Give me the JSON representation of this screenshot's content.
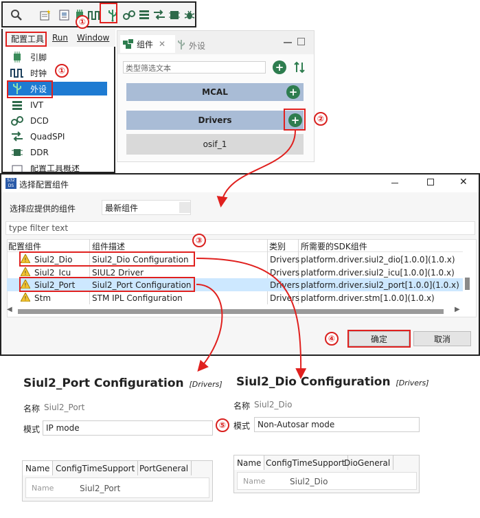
{
  "markers": {
    "m1": "①",
    "m2": "②",
    "m3": "③",
    "m4": "④",
    "m5": "⑤"
  },
  "menu_bar": {
    "items": [
      "配置工具",
      "Run",
      "Window"
    ]
  },
  "left_menu": {
    "items": [
      {
        "label": "引脚",
        "icon": "chip-icon"
      },
      {
        "label": "时钟",
        "icon": "clock-wave-icon"
      },
      {
        "label": "外设",
        "icon": "usb-icon"
      },
      {
        "label": "IVT",
        "icon": "list-icon"
      },
      {
        "label": "DCD",
        "icon": "dcd-icon"
      },
      {
        "label": "QuadSPI",
        "icon": "quadspi-icon"
      },
      {
        "label": "DDR",
        "icon": "ddr-icon"
      },
      {
        "label": "配置工具概述",
        "icon": "overview-icon"
      }
    ]
  },
  "component_panel": {
    "tab_components": "组件",
    "tab_peripherals": "外设",
    "filter_placeholder": "类型筛选文本",
    "groups": [
      {
        "label": "MCAL"
      },
      {
        "label": "Drivers"
      }
    ],
    "child": "osif_1"
  },
  "dialog": {
    "title": "选择配置组件",
    "provider_label": "选择应提供的组件",
    "provider_value": "最新组件",
    "filter_placeholder": "type filter text",
    "columns": [
      "配置组件",
      "组件描述",
      "类别",
      "所需要的SDK组件"
    ],
    "rows": [
      {
        "name": "Siul2_Dio",
        "desc": "Siul2_Dio Configuration",
        "cat": "Drivers",
        "sdk": "platform.driver.siul2_dio[1.0.0](1.0.x)"
      },
      {
        "name": "Siul2_Icu",
        "desc": "SIUL2 Driver",
        "cat": "Drivers",
        "sdk": "platform.driver.siul2_icu[1.0.0](1.0.x)"
      },
      {
        "name": "Siul2_Port",
        "desc": "Siul2_Port Configuration",
        "cat": "Drivers",
        "sdk": "platform.driver.siul2_port[1.0.0](1.0.x)"
      },
      {
        "name": "Stm",
        "desc": "STM IPL Configuration",
        "cat": "Drivers",
        "sdk": "platform.driver.stm[1.0.0](1.0.x)"
      }
    ],
    "ok": "确定",
    "cancel": "取消"
  },
  "port_view": {
    "title": "Siul2_Port Configuration",
    "category": "[Drivers]",
    "name_label": "名称",
    "name_value": "Siul2_Port",
    "mode_label": "模式",
    "mode_value": "IP mode",
    "tabs": [
      "Name",
      "ConfigTimeSupport",
      "PortGeneral"
    ],
    "row_name_label": "Name",
    "row_name_value": "Siul2_Port"
  },
  "dio_view": {
    "title": "Siul2_Dio Configuration",
    "category": "[Drivers]",
    "name_label": "名称",
    "name_value": "Siul2_Dio",
    "mode_label": "模式",
    "mode_value": "Non-Autosar mode",
    "tabs": [
      "Name",
      "ConfigTimeSupport",
      "DioGeneral"
    ],
    "row_name_label": "Name",
    "row_name_value": "Siul2_Dio"
  },
  "colors": {
    "accent_red": "#e0201e",
    "green": "#2e7d4f",
    "group_blue": "#a9bcd6",
    "selection": "#cde8ff"
  }
}
